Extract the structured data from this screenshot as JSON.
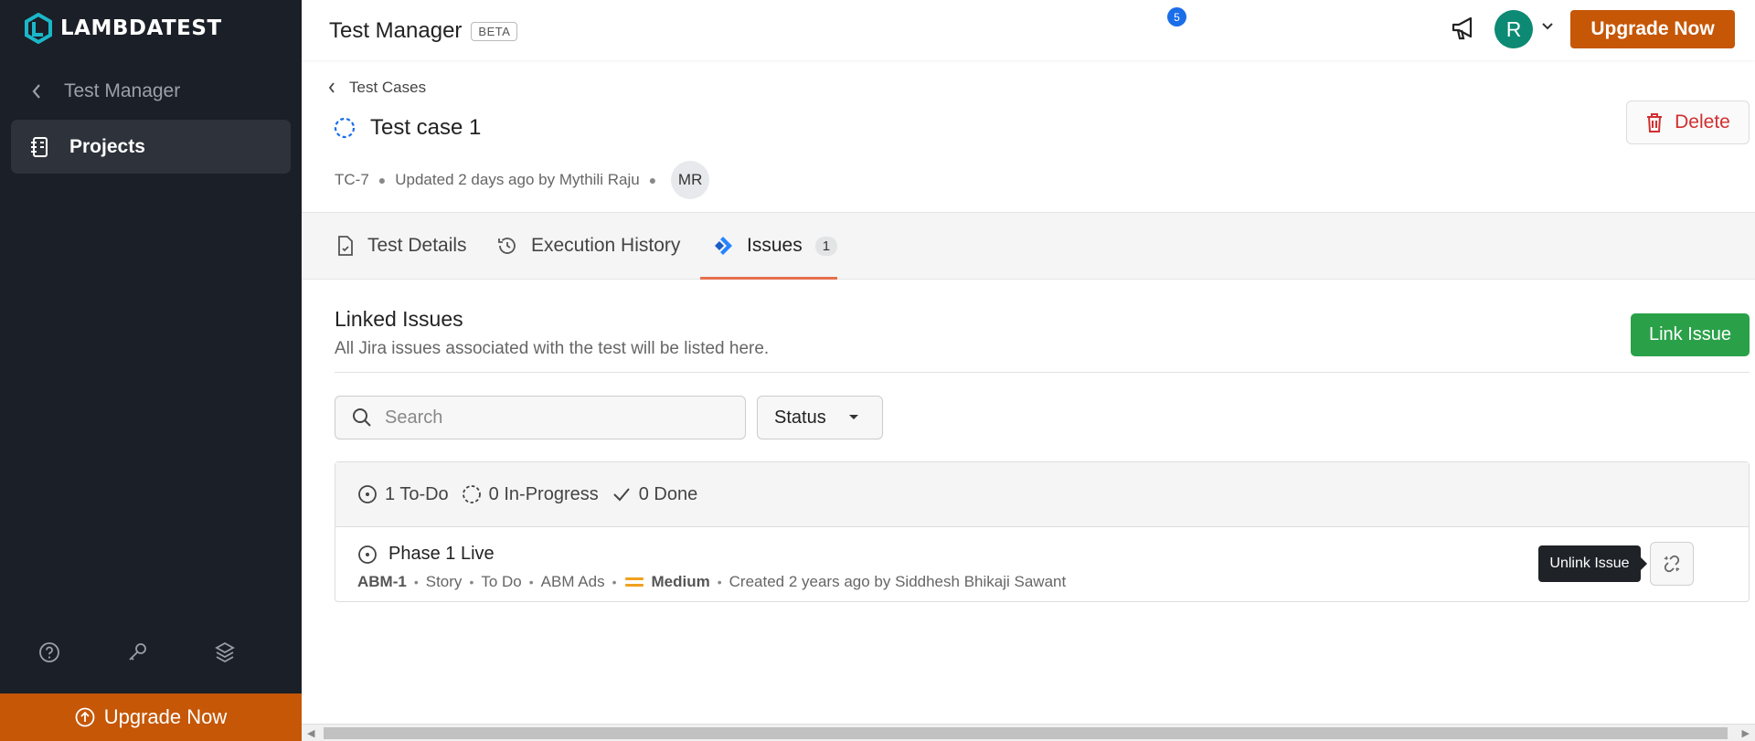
{
  "brand": {
    "name": "LAMBDATEST"
  },
  "sidebar": {
    "back_label": "Test Manager",
    "projects_label": "Projects",
    "upgrade_label": "Upgrade Now"
  },
  "topbar": {
    "title": "Test Manager",
    "beta": "BETA",
    "notif_count": "5",
    "avatar_initial": "R",
    "upgrade_label": "Upgrade Now"
  },
  "header": {
    "breadcrumb": "Test Cases",
    "case_title": "Test case 1",
    "case_id": "TC-7",
    "updated": "Updated 2 days ago by Mythili Raju",
    "owner_initials": "MR",
    "delete_label": "Delete"
  },
  "tabs": [
    {
      "label": "Test Details"
    },
    {
      "label": "Execution History"
    },
    {
      "label": "Issues",
      "count": "1"
    }
  ],
  "linked": {
    "title": "Linked Issues",
    "subtitle": "All Jira issues associated with the test will be listed here.",
    "link_button": "Link Issue",
    "search_placeholder": "Search",
    "status_label": "Status"
  },
  "summary": {
    "todo": "1 To-Do",
    "inprogress": "0 In-Progress",
    "done": "0 Done"
  },
  "issues": [
    {
      "title": "Phase 1 Live",
      "key": "ABM-1",
      "type": "Story",
      "status": "To Do",
      "project": "ABM Ads",
      "priority": "Medium",
      "created": "Created 2 years ago by Siddhesh Bhikaji Sawant",
      "tooltip": "Unlink Issue"
    }
  ],
  "colors": {
    "accent": "#c55707",
    "green": "#2aa149",
    "sidebar": "#1b1f27",
    "danger": "#d12f2f"
  }
}
